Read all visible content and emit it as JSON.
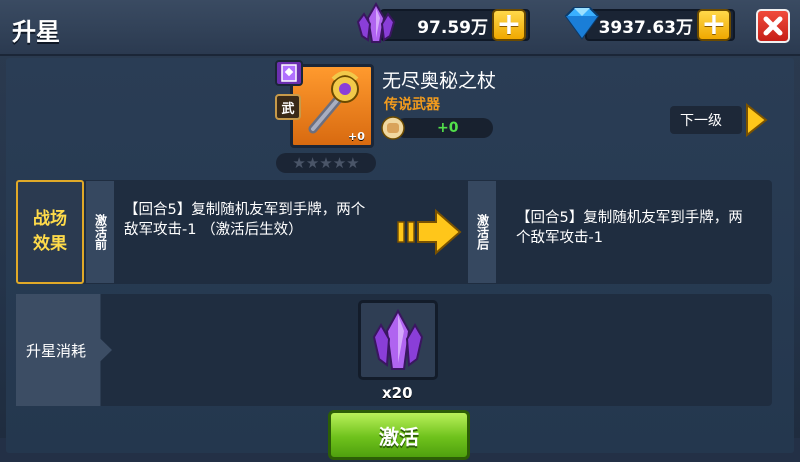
{
  "header": {
    "title": "升星",
    "resource_crystal": "97.59万",
    "resource_diamond": "3937.63万",
    "plus_label": "+"
  },
  "item": {
    "name": "无尽奥秘之杖",
    "type": "传说武器",
    "category_badge": "武",
    "level_badge": "+0",
    "power": "+0",
    "stars": "★★★★★"
  },
  "next_button": "下一级",
  "effect": {
    "section_label": "战场效果",
    "before_tab": "激活前",
    "after_tab": "激活后",
    "before_text": "【回合5】复制随机友军到手牌，两个敌军攻击-1 （激活后生效）",
    "after_text": "【回合5】复制随机友军到手牌，两个敌军攻击-1"
  },
  "cost": {
    "label": "升星消耗",
    "quantity": "x20"
  },
  "activate_button": "激活",
  "colors": {
    "accent_gold": "#ffdb4a",
    "legend_orange": "#f29b1d",
    "power_green": "#52e04a",
    "button_green": "#6fc21c",
    "close_red": "#e03a2a"
  }
}
